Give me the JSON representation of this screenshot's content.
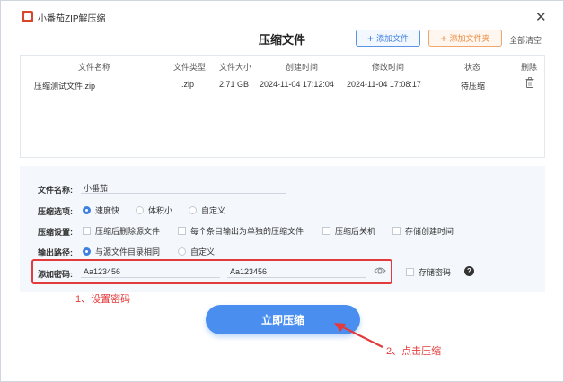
{
  "app": {
    "title": "小番茄ZIP解压缩",
    "page_title": "压缩文件"
  },
  "toolbar": {
    "add_file": "添加文件",
    "add_folder": "添加文件夹",
    "clear_all": "全部清空"
  },
  "table": {
    "headers": [
      "文件名称",
      "文件类型",
      "文件大小",
      "创建时间",
      "修改时间",
      "状态",
      "删除"
    ],
    "rows": [
      {
        "name": "压缩测试文件.zip",
        "type": ".zip",
        "size": "2.71 GB",
        "created": "2024-11-04 17:12:04",
        "modified": "2024-11-04 17:08:17",
        "status": "待压缩"
      }
    ]
  },
  "settings": {
    "name_label": "文件名称:",
    "name_value": "小番茄",
    "options_label": "压缩选项:",
    "options": [
      "速度快",
      "体积小",
      "自定义"
    ],
    "options_selected": 0,
    "config_label": "压缩设置:",
    "config_checks": [
      "压缩后删除源文件",
      "每个条目输出为单独的压缩文件",
      "压缩后关机",
      "存储创建时间"
    ],
    "output_label": "输出路径:",
    "output_options": [
      "与源文件目录相同",
      "自定义"
    ],
    "output_selected": 0,
    "password_label": "添加密码:",
    "password_value": "Aa123456",
    "password_confirm": "Aa123456",
    "store_password": "存储密码"
  },
  "actions": {
    "compress_now": "立即压缩"
  },
  "annotations": {
    "step1": "1、设置密码",
    "step2": "2、点击压缩",
    "color": "#e33b3b"
  },
  "colors": {
    "accent": "#4a8ef0",
    "orange": "#ee8a3d"
  }
}
